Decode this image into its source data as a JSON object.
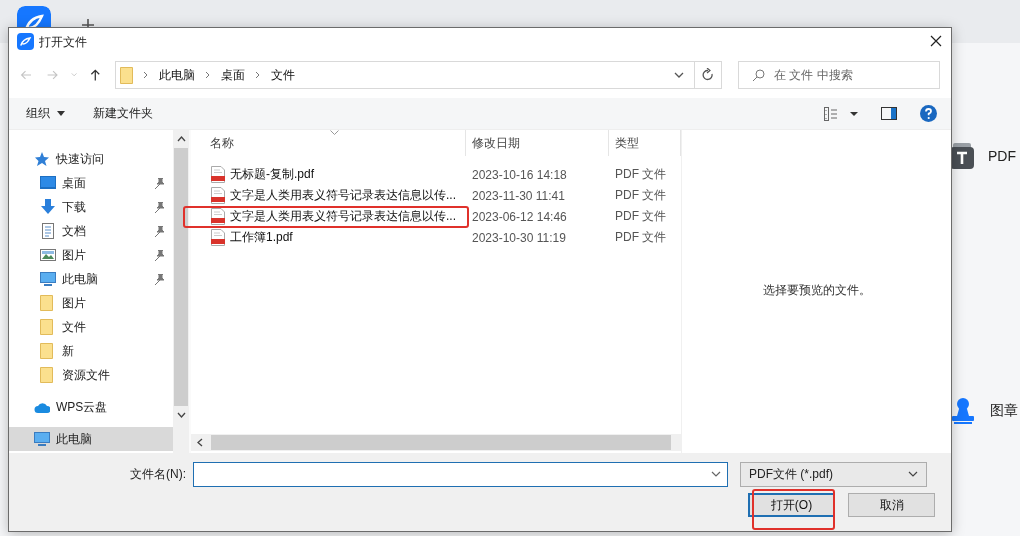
{
  "app": {
    "tools": [
      {
        "kind": "text",
        "label": "PDF"
      },
      {
        "kind": "stamp",
        "label": "图章"
      }
    ]
  },
  "dialog": {
    "title": "打开文件",
    "nav": {
      "back": {
        "disabled": true
      },
      "forward": {
        "disabled": true
      },
      "up": {
        "disabled": false
      }
    },
    "address": {
      "crumbs": [
        "此电脑",
        "桌面",
        "文件"
      ]
    },
    "search": {
      "placeholder": "在 文件 中搜索"
    },
    "toolbar": {
      "organize": "组织",
      "new_folder": "新建文件夹"
    },
    "sidebar": [
      {
        "label": "快速访问",
        "kind": "star",
        "selected": false,
        "children": [
          {
            "label": "桌面",
            "kind": "desktop",
            "pinned": true,
            "selected": false
          },
          {
            "label": "下载",
            "kind": "download",
            "pinned": true,
            "selected": false
          },
          {
            "label": "文档",
            "kind": "document",
            "pinned": true,
            "selected": false
          },
          {
            "label": "图片",
            "kind": "pictures",
            "pinned": true,
            "selected": false
          },
          {
            "label": "此电脑",
            "kind": "pc",
            "pinned": true,
            "selected": false
          },
          {
            "label": "图片",
            "kind": "folder",
            "pinned": false,
            "selected": false
          },
          {
            "label": "文件",
            "kind": "folder",
            "pinned": false,
            "selected": false
          },
          {
            "label": "新",
            "kind": "folder",
            "pinned": false,
            "selected": false
          },
          {
            "label": "资源文件",
            "kind": "folder",
            "pinned": false,
            "selected": false
          }
        ]
      },
      {
        "label": "WPS云盘",
        "kind": "cloud",
        "selected": false
      },
      {
        "label": "此电脑",
        "kind": "pc",
        "selected": true
      }
    ],
    "columns": [
      "名称",
      "修改日期",
      "类型"
    ],
    "files": [
      {
        "name": "无标题-复制.pdf",
        "date": "2023-10-16 14:18",
        "type": "PDF 文件",
        "highlighted": false
      },
      {
        "name": "文字是人类用表义符号记录表达信息以传...",
        "date": "2023-11-30 11:41",
        "type": "PDF 文件",
        "highlighted": false
      },
      {
        "name": "文字是人类用表义符号记录表达信息以传...",
        "date": "2023-06-12 14:46",
        "type": "PDF 文件",
        "highlighted": true
      },
      {
        "name": "工作簿1.pdf",
        "date": "2023-10-30 11:19",
        "type": "PDF 文件",
        "highlighted": false
      }
    ],
    "preview_message": "选择要预览的文件。",
    "filename_label": "文件名(N):",
    "filter": "PDF文件 (*.pdf)",
    "buttons": [
      {
        "label": "打开(O)",
        "kind": "primary",
        "highlighted": true
      },
      {
        "label": "取消",
        "kind": "secondary",
        "highlighted": false
      }
    ]
  }
}
